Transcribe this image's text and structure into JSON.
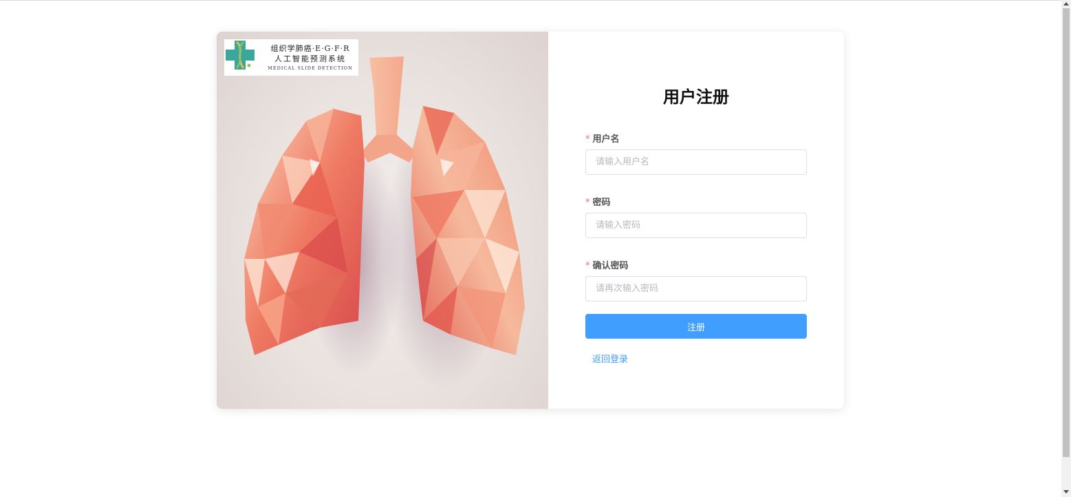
{
  "logo": {
    "line1": "组织学肺癌·E·G·F·R",
    "line2": "人工智能预测系统",
    "line3": "MEDICAL SLIDE DETECTION",
    "icon": "medical-cross-dna-icon"
  },
  "form": {
    "title": "用户注册",
    "username": {
      "label": "用户名",
      "required_mark": "*",
      "placeholder": "请输入用户名",
      "value": ""
    },
    "password": {
      "label": "密码",
      "required_mark": "*",
      "placeholder": "请输入密码",
      "value": ""
    },
    "confirm": {
      "label": "确认密码",
      "required_mark": "*",
      "placeholder": "请再次输入密码",
      "value": ""
    },
    "submit_label": "注册",
    "back_link": "返回登录"
  },
  "colors": {
    "primary": "#409eff",
    "required": "#f56c6c",
    "logo_teal": "#3aa79a",
    "lung_main": "#e8604f"
  }
}
